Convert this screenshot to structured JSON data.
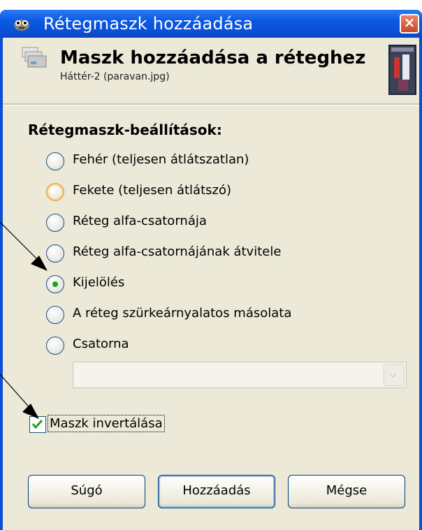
{
  "window": {
    "title": "Rétegmaszk hozzáadása",
    "close_glyph": "×",
    "title_icon": "gimp-wilber-icon"
  },
  "header": {
    "title": "Maszk hozzáadása a réteghez",
    "subtitle": "Háttér-2 (paravan.jpg)",
    "icon": "layer-mask-icon",
    "thumbnail": "layer-thumbnail"
  },
  "options": {
    "label": "Rétegmaszk-beállítások:",
    "items": [
      {
        "label": "Fehér (teljesen átlátszatlan)",
        "selected": false
      },
      {
        "label": "Fekete (teljesen átlátszó)",
        "selected": false
      },
      {
        "label": "Réteg alfa-csatornája",
        "selected": false
      },
      {
        "label": "Réteg alfa-csatornájának átvitele",
        "selected": false
      },
      {
        "label": "Kijelölés",
        "selected": true
      },
      {
        "label": "A réteg szürkeárnyalatos másolata",
        "selected": false
      },
      {
        "label": "Csatorna",
        "selected": false
      }
    ],
    "channel_value": "",
    "channel_dropdown_glyph": "⌵"
  },
  "invert": {
    "label": "Maszk invertálása",
    "checked": true,
    "check_glyph": "✔"
  },
  "buttons": {
    "help": "Súgó",
    "add": "Hozzáadás",
    "cancel": "Mégse"
  },
  "colors": {
    "titlebar": "#0a4fd6",
    "dialog_bg": "#ece9d8",
    "radio_dot": "#21a121",
    "checkmark": "#21a121"
  }
}
